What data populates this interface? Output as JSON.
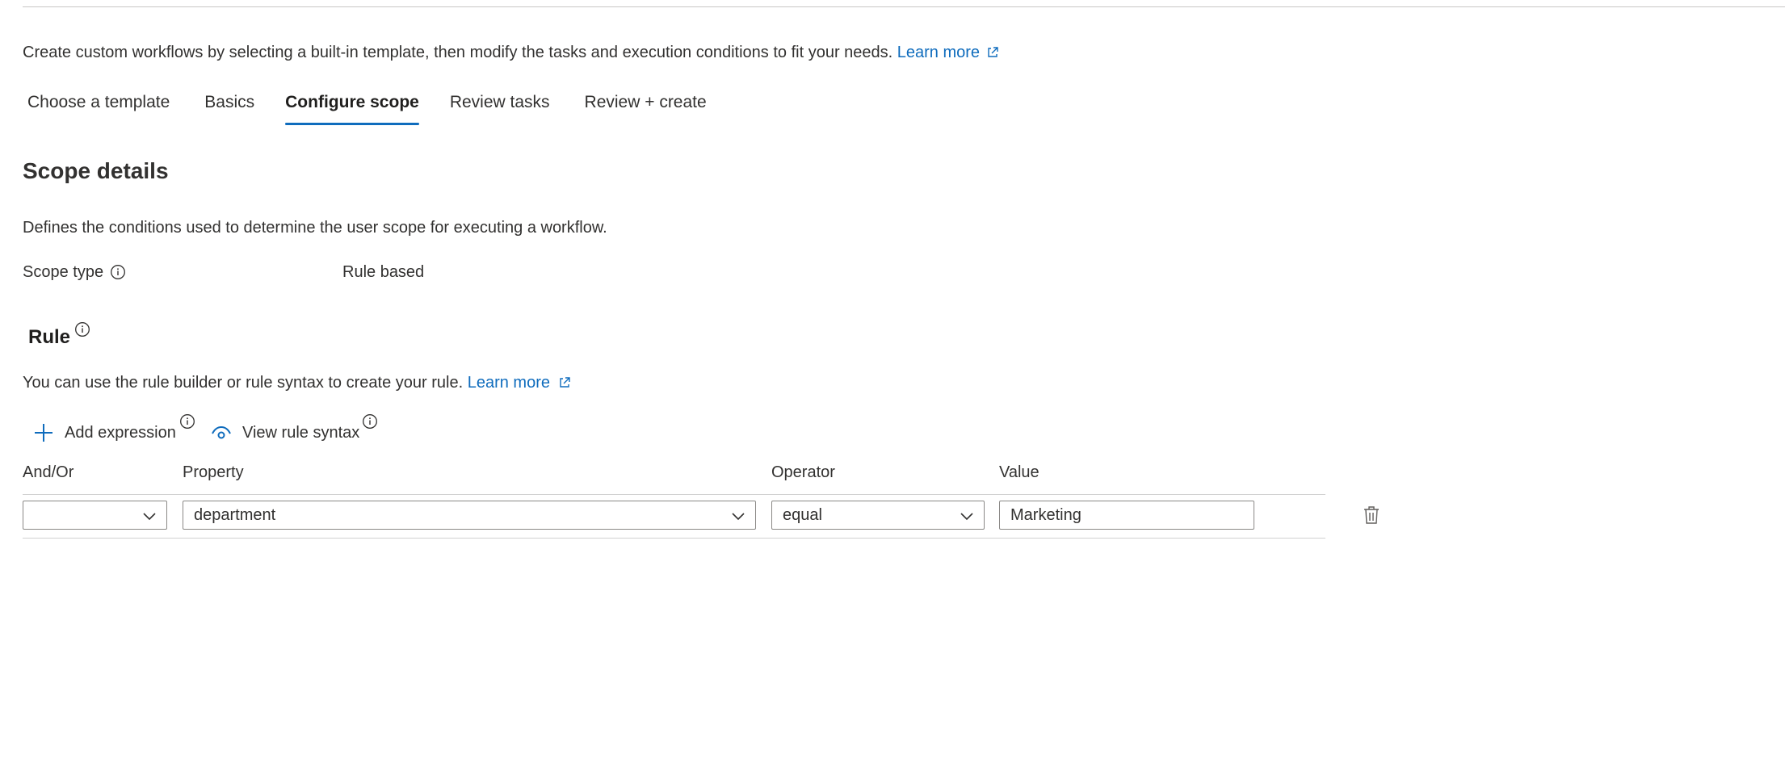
{
  "intro": {
    "text": "Create custom workflows by selecting a built-in template, then modify the tasks and execution conditions to fit your needs.",
    "learn_more": "Learn more"
  },
  "tabs": [
    {
      "label": "Choose a template",
      "active": false
    },
    {
      "label": "Basics",
      "active": false
    },
    {
      "label": "Configure scope",
      "active": true
    },
    {
      "label": "Review tasks",
      "active": false
    },
    {
      "label": "Review + create",
      "active": false
    }
  ],
  "scope": {
    "title": "Scope details",
    "description": "Defines the conditions used to determine the user scope for executing a workflow.",
    "type_label": "Scope type",
    "type_value": "Rule based"
  },
  "rule": {
    "title": "Rule",
    "description": "You can use the rule builder or rule syntax to create your rule.",
    "learn_more": "Learn more",
    "add_expression": "Add expression",
    "view_syntax": "View rule syntax"
  },
  "grid": {
    "headers": {
      "and_or": "And/Or",
      "property": "Property",
      "operator": "Operator",
      "value": "Value"
    },
    "rows": [
      {
        "and_or": "",
        "property": "department",
        "operator": "equal",
        "value": "Marketing"
      }
    ]
  },
  "colors": {
    "accent": "#0f6cbd",
    "text": "#323130",
    "border": "#8a8886"
  },
  "icons": {
    "external_link": "external-link-icon",
    "info": "info-icon",
    "add": "plus-icon",
    "view": "eye-icon",
    "chevron": "chevron-down-icon",
    "delete": "trash-icon"
  }
}
